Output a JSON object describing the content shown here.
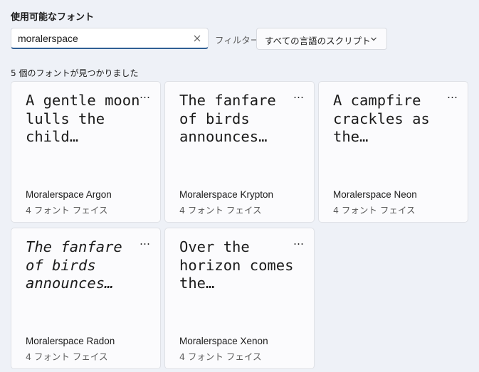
{
  "header": {
    "title": "使用可能なフォント"
  },
  "search": {
    "value": "moralerspace",
    "clear_icon": "close-icon"
  },
  "filter": {
    "label": "フィルター:",
    "selected": "すべての言語のスクリプト",
    "icon": "chevron-down-icon"
  },
  "results": {
    "count_text": "5 個のフォントが見つかりました"
  },
  "cards": [
    {
      "preview": "A gentle moon lulls the child…",
      "name": "Moralerspace Argon",
      "faces": "4 フォント フェイス",
      "more": "…"
    },
    {
      "preview": "The fanfare of birds announces…",
      "name": "Moralerspace Krypton",
      "faces": "4 フォント フェイス",
      "more": "…"
    },
    {
      "preview": "A campfire crackles as the…",
      "name": "Moralerspace Neon",
      "faces": "4 フォント フェイス",
      "more": "…"
    },
    {
      "preview": "The fanfare of birds announces…",
      "name": "Moralerspace Radon",
      "faces": "4 フォント フェイス",
      "more": "…"
    },
    {
      "preview": "Over the horizon comes the…",
      "name": "Moralerspace Xenon",
      "faces": "4 フォント フェイス",
      "more": "…"
    }
  ],
  "colors": {
    "background": "#eef1f7",
    "card": "#fbfbfd",
    "accent": "#2f5f94",
    "text": "#1b1b1b",
    "secondary_text": "#5d5d5d"
  }
}
